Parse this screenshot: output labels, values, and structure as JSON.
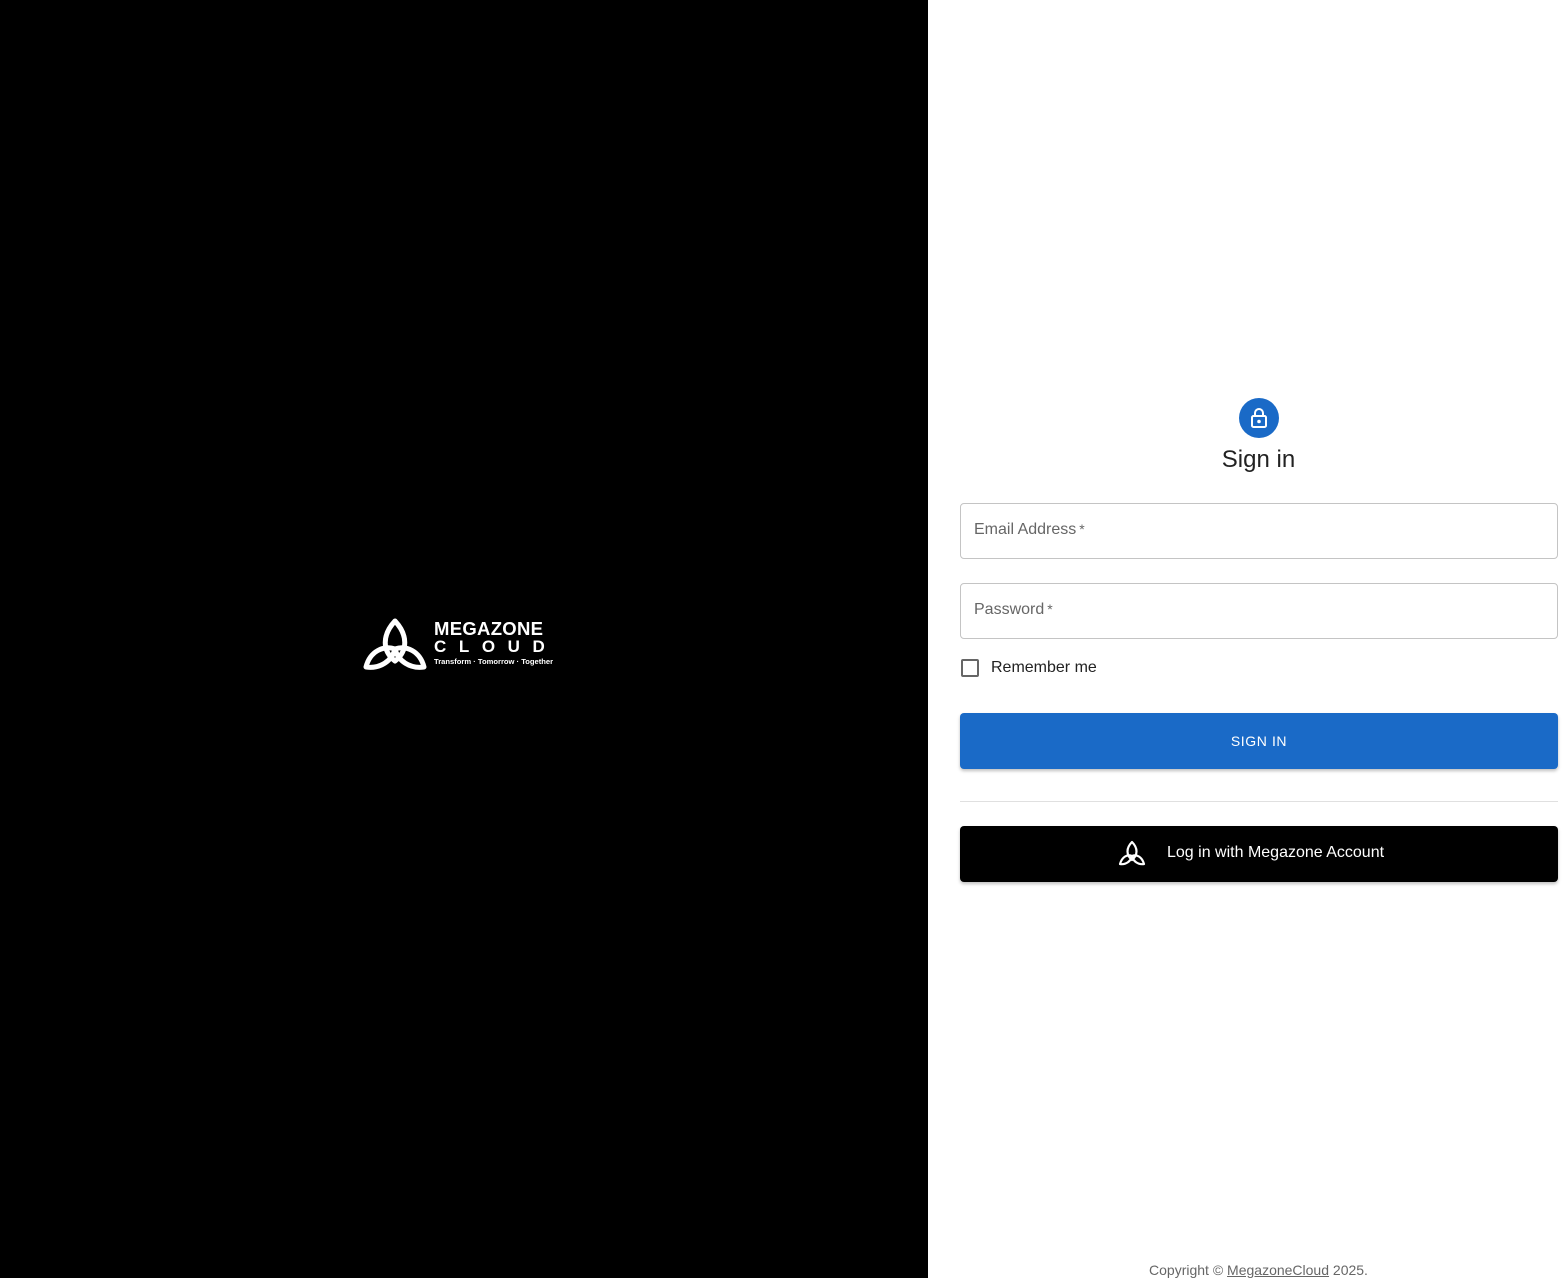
{
  "brand": {
    "name": "MEGAZONE",
    "sub": "CLOUD",
    "tagline": "Transform · Tomorrow · Together"
  },
  "signin": {
    "title": "Sign in",
    "email": {
      "label": "Email Address",
      "required_mark": "*"
    },
    "password": {
      "label": "Password",
      "required_mark": "*"
    },
    "remember_label": "Remember me",
    "remember_checked": false,
    "submit_label": "SIGN IN",
    "sso_label": "Log in with Megazone Account"
  },
  "footer": {
    "prefix": "Copyright © ",
    "link": "MegazoneCloud",
    "suffix": " 2025."
  },
  "colors": {
    "primary": "#1a6ac7",
    "left_panel": "#000000",
    "sso_button": "#000000"
  },
  "icons": {
    "avatar": "lock-icon",
    "brand": "triquetra-logo",
    "sso": "triquetra-icon"
  }
}
